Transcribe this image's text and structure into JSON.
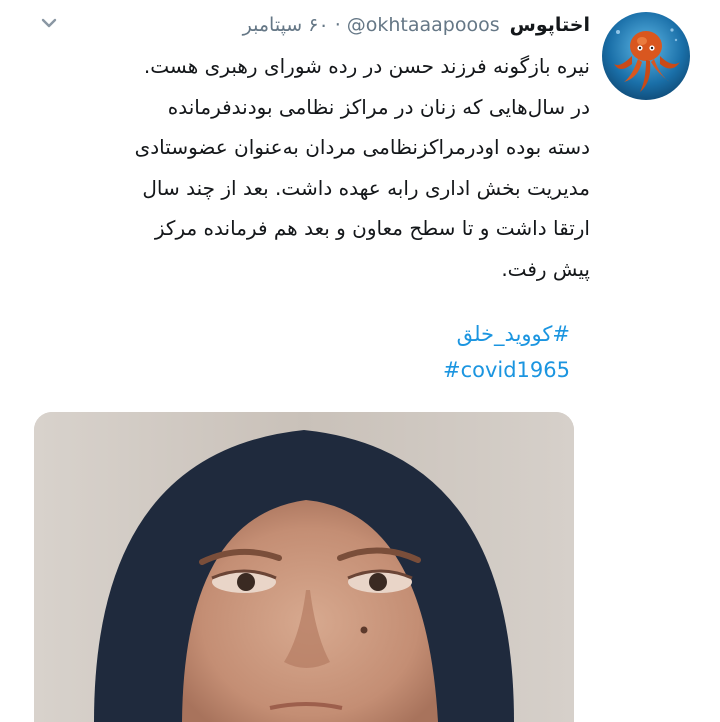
{
  "tweet": {
    "display_name": "اختاپوس",
    "handle": "@okhtaaapooos",
    "separator": "·",
    "time": "۶۰ سپتامبر",
    "lines": [
      "نیره بازگونه فرزند حسن در رده شورای رهبری هست.",
      "در سال‌هایی که زنان در مراکز نظامی بودندفرمانده",
      "دسته بوده اودرمراکزنظامی مردان به‌عنوان عضوستادی",
      "مدیریت بخش  اداری رابه عهده داشت. بعد از چند سال",
      "ارتقا داشت و تا سطح معاون و بعد هم فرمانده مرکز",
      "پیش رفت."
    ],
    "hashtags": [
      "#کووید_خلق",
      "#covid1965"
    ]
  },
  "icons": {
    "avatar": "octopus-avatar",
    "more": "chevron-down-icon",
    "media": "photo-attachment"
  },
  "colors": {
    "hashtag": "#1b95e0",
    "secondary_text": "#657786",
    "primary_text": "#14171a",
    "avatar_bg": "#1a6fa8"
  }
}
